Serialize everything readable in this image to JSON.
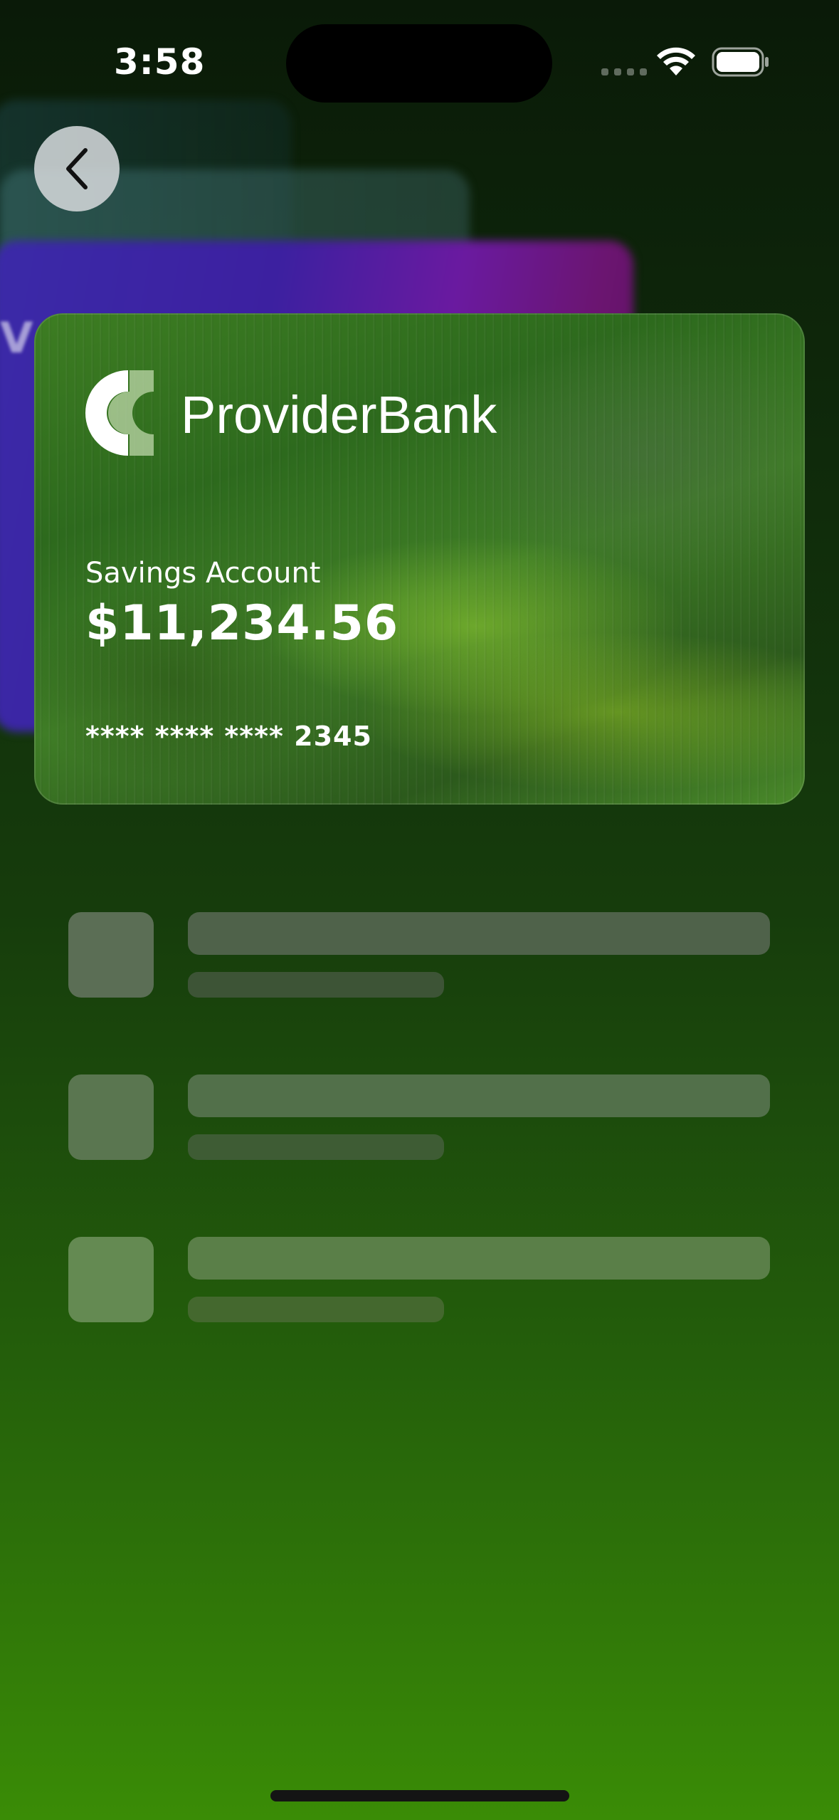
{
  "status_bar": {
    "time": "3:58"
  },
  "navigation": {
    "back_icon": "chevron-left-icon"
  },
  "background_card": {
    "partial_text": "V"
  },
  "card": {
    "bank_name": "ProviderBank",
    "logo_icon": "provider-bank-logo",
    "account_type": "Savings Account",
    "balance": "$11,234.56",
    "card_number": "**** **** **** 2345"
  },
  "colors": {
    "thumb_1": "#5b6e55",
    "line1_1": "#4f624a",
    "line2_1": "#3d5436",
    "thumb_2": "#5a7650",
    "line1_2": "#52704a",
    "line2_2": "#3e5c34",
    "thumb_3": "#648a52",
    "line1_3": "#5a7f48",
    "line2_3": "#44682e"
  }
}
